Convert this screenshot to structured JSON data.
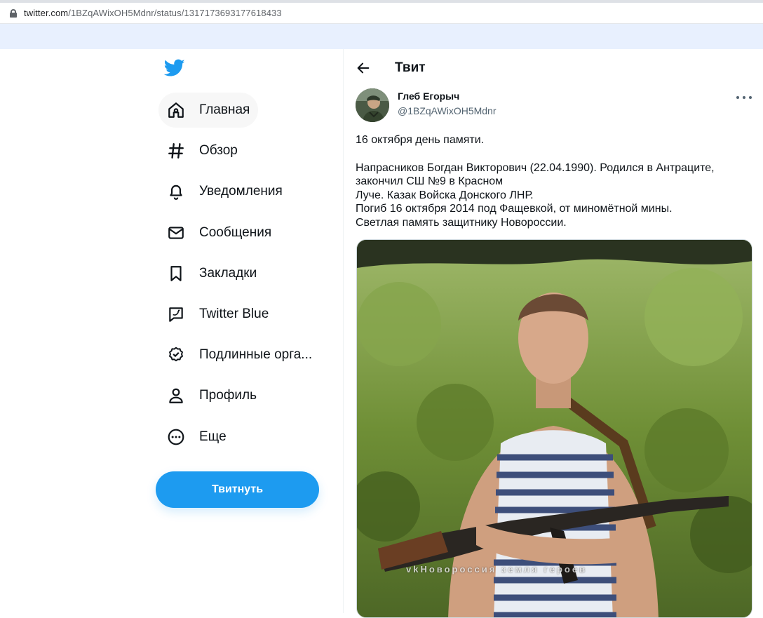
{
  "browser": {
    "url_host": "twitter.com",
    "url_path": "/1BZqAWixOH5Mdnr/status/1317173693177618433"
  },
  "sidebar": {
    "logo_icon": "twitter-bird-icon",
    "items": [
      {
        "label": "Главная",
        "icon": "home-icon"
      },
      {
        "label": "Обзор",
        "icon": "hashtag-icon"
      },
      {
        "label": "Уведомления",
        "icon": "bell-icon"
      },
      {
        "label": "Сообщения",
        "icon": "envelope-icon"
      },
      {
        "label": "Закладки",
        "icon": "bookmark-icon"
      },
      {
        "label": "Twitter Blue",
        "icon": "twitter-blue-icon"
      },
      {
        "label": "Подлинные орга...",
        "icon": "verified-badge-icon"
      },
      {
        "label": "Профиль",
        "icon": "person-icon"
      },
      {
        "label": "Еще",
        "icon": "more-circle-icon"
      }
    ],
    "tweet_button": "Твитнуть"
  },
  "main": {
    "header_title": "Твит",
    "author": {
      "name": "Глеб Егорыч",
      "handle": "@1BZqAWixOH5Mdnr"
    },
    "tweet_lines": [
      "16 октября день памяти.",
      "Напрасников Богдан Викторович (22.04.1990). Родился в Антраците,",
      "закончил СШ №9 в Красном",
      "Луче. Казак Войска Донского ЛНР.",
      "Погиб 16 октября 2014 под Фащевкой, от миномётной мины.",
      "Светлая память защитнику Новороссии."
    ],
    "media_watermark": "vkНовороссия земля героев"
  },
  "colors": {
    "accent": "#1d9bf0",
    "text": "#0f1419",
    "secondary_text": "#536471"
  }
}
